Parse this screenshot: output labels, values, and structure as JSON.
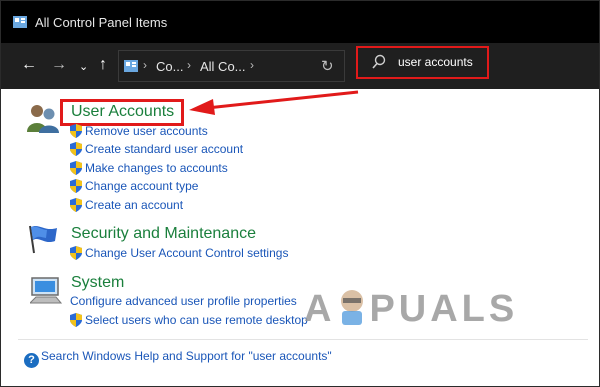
{
  "window": {
    "title": "All Control Panel Items"
  },
  "address_bar": {
    "crumbs": [
      "Co...",
      "All Co..."
    ],
    "search_value": "user accounts"
  },
  "categories": [
    {
      "title": "User Accounts",
      "icon": "users-icon",
      "tasks": [
        {
          "label": "Remove user accounts",
          "shield": true
        },
        {
          "label": "Create standard user account",
          "shield": true
        },
        {
          "label": "Make changes to accounts",
          "shield": true
        },
        {
          "label": "Change account type",
          "shield": true
        },
        {
          "label": "Create an account",
          "shield": true
        }
      ]
    },
    {
      "title": "Security and Maintenance",
      "icon": "flag-icon",
      "tasks": [
        {
          "label": "Change User Account Control settings",
          "shield": true
        }
      ]
    },
    {
      "title": "System",
      "icon": "computer-icon",
      "tasks": [
        {
          "label": "Configure advanced user profile properties",
          "shield": false
        },
        {
          "label": "Select users who can use remote desktop",
          "shield": true
        }
      ]
    }
  ],
  "help": {
    "text": "Search Windows Help and Support for \"user accounts\""
  },
  "watermark": {
    "text": "A PUALS"
  },
  "colors": {
    "highlight": "#e11a1a",
    "category": "#1a7f3c",
    "link": "#1a56b8"
  }
}
